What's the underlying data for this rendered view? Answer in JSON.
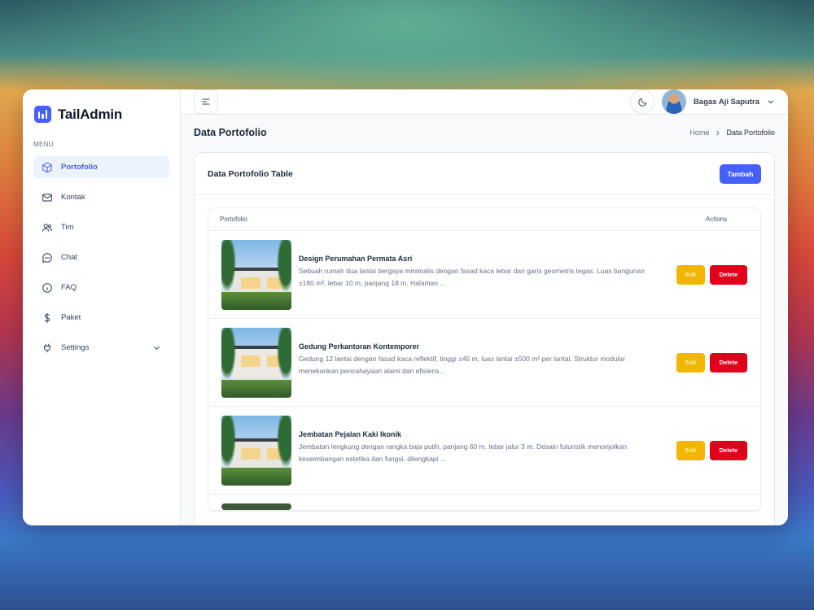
{
  "brand": {
    "name": "TailAdmin"
  },
  "sidebar": {
    "menu_label": "MENU",
    "items": [
      {
        "label": "Portofolio",
        "icon": "cube-icon",
        "active": true
      },
      {
        "label": "Kontak",
        "icon": "mail-icon"
      },
      {
        "label": "Tim",
        "icon": "users-icon"
      },
      {
        "label": "Chat",
        "icon": "chat-icon"
      },
      {
        "label": "FAQ",
        "icon": "info-icon"
      },
      {
        "label": "Paket",
        "icon": "dollar-icon"
      },
      {
        "label": "Settings",
        "icon": "plug-icon",
        "has_submenu": true
      }
    ]
  },
  "header": {
    "user_name": "Bagas Aji Saputra"
  },
  "page": {
    "title": "Data Portofolio",
    "breadcrumb": {
      "home": "Home",
      "current": "Data Portofolio"
    }
  },
  "card": {
    "title": "Data Portofolio Table",
    "add_button": "Tambah"
  },
  "table": {
    "columns": {
      "portfolio": "Portofolio",
      "actions": "Actions"
    },
    "edit_label": "Edit",
    "delete_label": "Delete",
    "rows": [
      {
        "title": "Design Perumahan Permata Asri",
        "description": "Sebuah rumah dua lantai bergaya minimalis dengan fasad kaca lebar dan garis geometris tegas. Luas bangunan ±180 m², lebar 10 m, panjang 18 m. Halaman ..."
      },
      {
        "title": "Gedung Perkantoran Kontemporer",
        "description": "Gedung 12 lantai dengan fasad kaca reflektif, tinggi ±45 m, luas lantai ±500 m² per lantai. Struktur modular menekankan pencahayaan alami dan efisiens..."
      },
      {
        "title": "Jembatan Pejalan Kaki Ikonik",
        "description": "Jembatan lengkung dengan rangka baja putih, panjang 60 m, lebar jalur 3 m. Desain futuristik menonjolkan keseimbangan estetika dan fungsi, dilengkapi ..."
      }
    ]
  },
  "colors": {
    "primary": "#465fff",
    "edit": "#f2b600",
    "delete": "#e0001b",
    "active_bg": "#ecf3ff"
  }
}
